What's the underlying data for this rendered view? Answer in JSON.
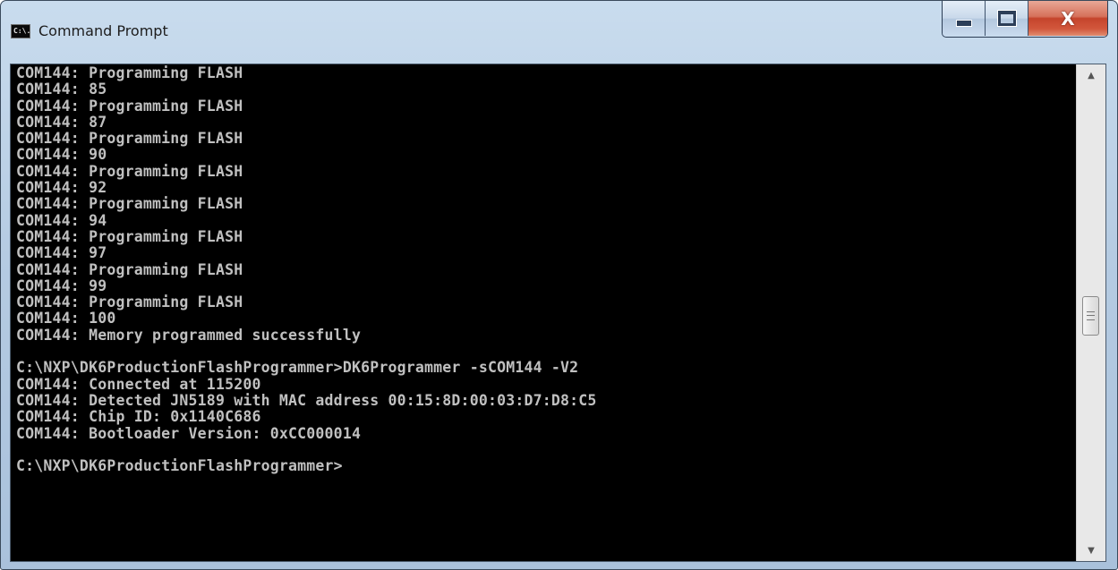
{
  "window": {
    "title": "Command Prompt",
    "icon": "console-icon",
    "icon_text": "C:\\.",
    "controls": {
      "minimize": "minimize-icon",
      "maximize": "maximize-icon",
      "close": "close-icon",
      "close_glyph": "X"
    }
  },
  "console": {
    "background": "#000000",
    "foreground": "#c0c0c0",
    "lines": [
      "COM144: Programming FLASH",
      "COM144: 85",
      "COM144: Programming FLASH",
      "COM144: 87",
      "COM144: Programming FLASH",
      "COM144: 90",
      "COM144: Programming FLASH",
      "COM144: 92",
      "COM144: Programming FLASH",
      "COM144: 94",
      "COM144: Programming FLASH",
      "COM144: 97",
      "COM144: Programming FLASH",
      "COM144: 99",
      "COM144: Programming FLASH",
      "COM144: 100",
      "COM144: Memory programmed successfully",
      "",
      "C:\\NXP\\DK6ProductionFlashProgrammer>DK6Programmer -sCOM144 -V2",
      "COM144: Connected at 115200",
      "COM144: Detected JN5189 with MAC address 00:15:8D:00:03:D7:D8:C5",
      "COM144: Chip ID: 0x1140C686",
      "COM144: Bootloader Version: 0xCC000014",
      "",
      "C:\\NXP\\DK6ProductionFlashProgrammer>"
    ]
  },
  "scrollbar": {
    "up_icon": "scroll-up-arrow-icon",
    "down_icon": "scroll-down-arrow-icon",
    "up_glyph": "▲",
    "down_glyph": "▼"
  }
}
